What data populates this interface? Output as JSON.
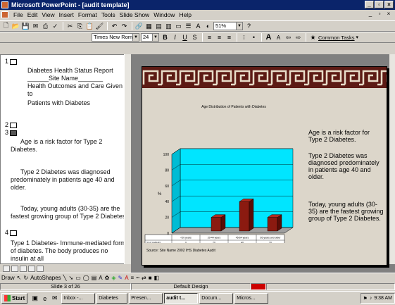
{
  "window": {
    "title": "Microsoft PowerPoint - [audit template]"
  },
  "menubar": {
    "items": [
      "File",
      "Edit",
      "View",
      "Insert",
      "Format",
      "Tools",
      "Slide Show",
      "Window",
      "Help"
    ]
  },
  "toolbar": {
    "zoom": "51%",
    "font_name": "Times New Roman",
    "font_size": "24",
    "common_tasks": "Common Tasks"
  },
  "outline": {
    "s1_num": "1",
    "s1_lines": [
      "Diabetes Health Status Report",
      "______Site Name_______",
      "Health Outcomes and Care Given to",
      "Patients with Diabetes"
    ],
    "s2_num": "2",
    "s3_num": "3",
    "s3_p1": "Age is a risk factor for Type 2 Diabetes.",
    "s3_p2": "Type 2 Diabetes was diagnosed predominately in patients age 40 and older.",
    "s3_p3": "Today, young adults (30-35) are the fastest growing group of Type 2 Diabetes.",
    "s4_num": "4",
    "s4_p1": "Type 1 Diabetes- Immune-mediated form of diabetes.  The body produces no insulin at all"
  },
  "slide": {
    "right_texts": [
      "Age is a risk factor for Type 2 Diabetes.",
      "Type 2 Diabetes was diagnosed predominately in patients age 40 and older.",
      "Today, young adults (30-35) are the fastest growing group of Type 2 Diabetes."
    ],
    "source": "Source: Site Name 2002 IHS Diabetes Audit"
  },
  "chart_data": {
    "type": "bar",
    "title": "Age Distribution of Patients with Diabetes",
    "ylabel": "%",
    "xlabel": "",
    "categories": [
      "<20 years",
      "20-44 years",
      "45-64 years",
      "65 years and older"
    ],
    "series": [
      {
        "name": "% of patients",
        "values": [
          0,
          20,
          40,
          20
        ]
      }
    ],
    "ylim": [
      0,
      100
    ],
    "yticks": [
      "0",
      "20",
      "40",
      "60",
      "80",
      "100"
    ],
    "data_table_label": "% of patients",
    "colors": {
      "bar": "#8b1a10",
      "wall": "#00e5ff"
    }
  },
  "drawbar": {
    "draw": "Draw",
    "autoshapes": "AutoShapes"
  },
  "status": {
    "slide": "Slide 3 of 26",
    "design": "Default Design"
  },
  "taskbar": {
    "start": "Start",
    "buttons": [
      "Inbox -...",
      "Diabetes",
      "Presen...",
      "audit t...",
      "Docum...",
      "Micros..."
    ],
    "clock": "9:38 AM"
  }
}
